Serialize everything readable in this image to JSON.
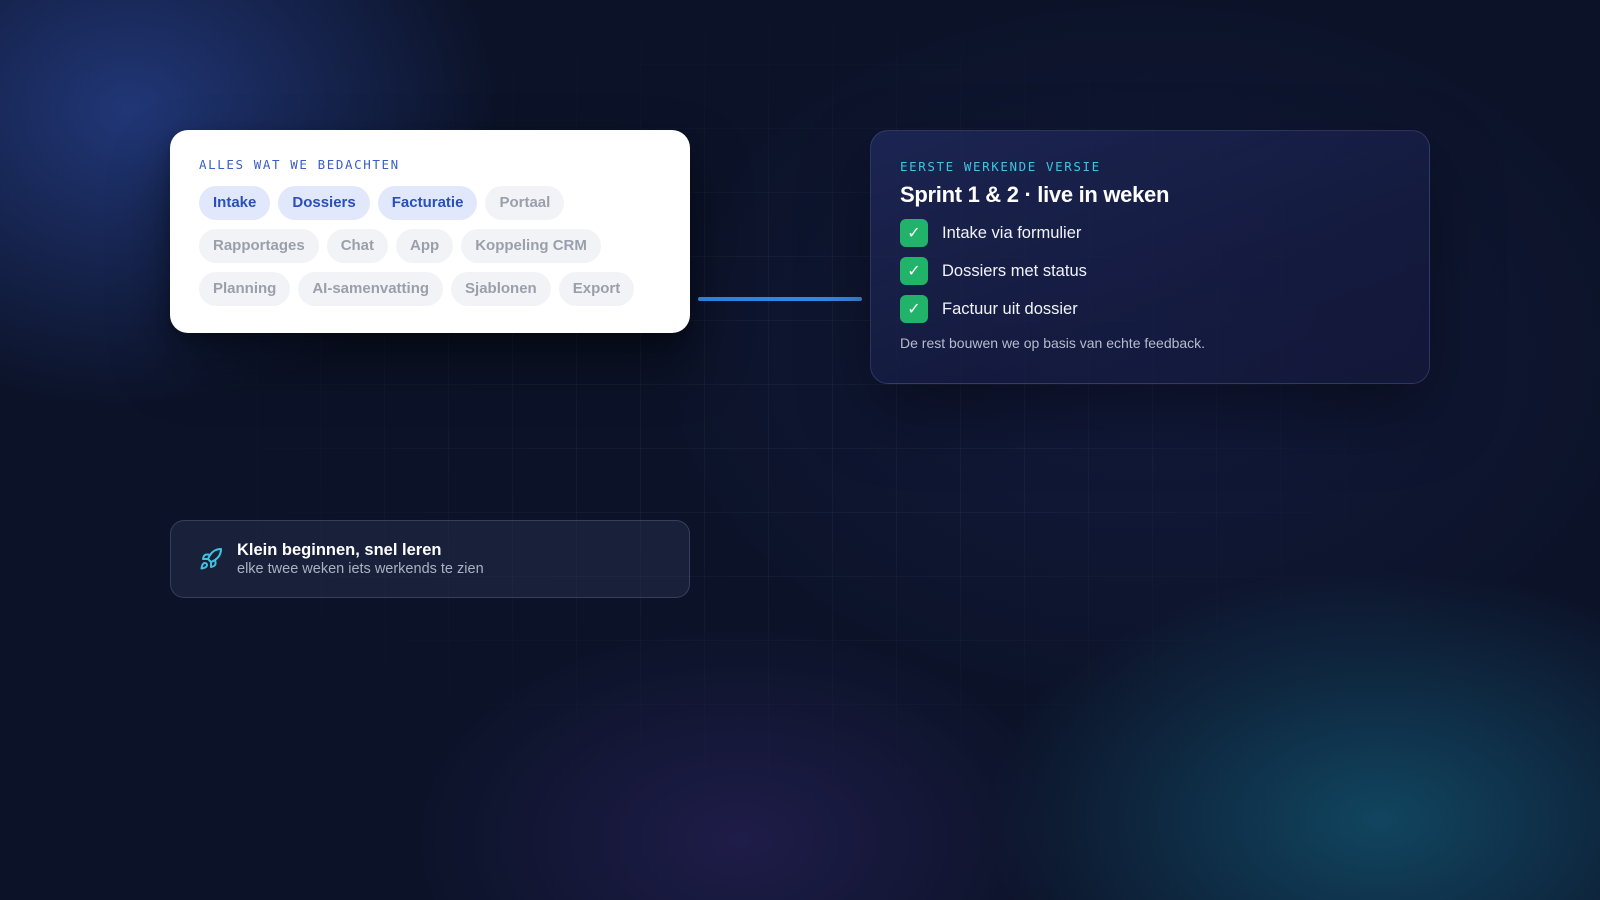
{
  "left_card": {
    "eyebrow": "ALLES WAT WE BEDACHTEN",
    "chips": [
      {
        "label": "Intake",
        "active": true
      },
      {
        "label": "Dossiers",
        "active": true
      },
      {
        "label": "Facturatie",
        "active": true
      },
      {
        "label": "Portaal",
        "active": false
      },
      {
        "label": "Rapportages",
        "active": false
      },
      {
        "label": "Chat",
        "active": false
      },
      {
        "label": "App",
        "active": false
      },
      {
        "label": "Koppeling CRM",
        "active": false
      },
      {
        "label": "Planning",
        "active": false
      },
      {
        "label": "AI-samenvatting",
        "active": false
      },
      {
        "label": "Sjablonen",
        "active": false
      },
      {
        "label": "Export",
        "active": false
      }
    ]
  },
  "right_card": {
    "eyebrow": "EERSTE WERKENDE VERSIE",
    "title": "Sprint 1 & 2 · live in weken",
    "items": [
      {
        "label": "Intake via formulier",
        "checked": true
      },
      {
        "label": "Dossiers met status",
        "checked": true
      },
      {
        "label": "Factuur uit dossier",
        "checked": true
      }
    ],
    "check_glyph": "✓",
    "footnote": "De rest bouwen we op basis van echte feedback."
  },
  "callout": {
    "icon": "rocket-icon",
    "title": "Klein beginnen, snel leren",
    "subtitle": "elke twee weken iets werkends te zien"
  },
  "colors": {
    "background": "#0c1329",
    "chip_active_bg": "#e1e8fb",
    "chip_active_text": "#2a4fb8",
    "chip_inactive_bg": "#f2f3f6",
    "chip_inactive_text": "#9aa0ab",
    "check_green": "#22b36b",
    "accent_cyan": "#3fc3df",
    "connector_blue": "#2b7fd6"
  }
}
